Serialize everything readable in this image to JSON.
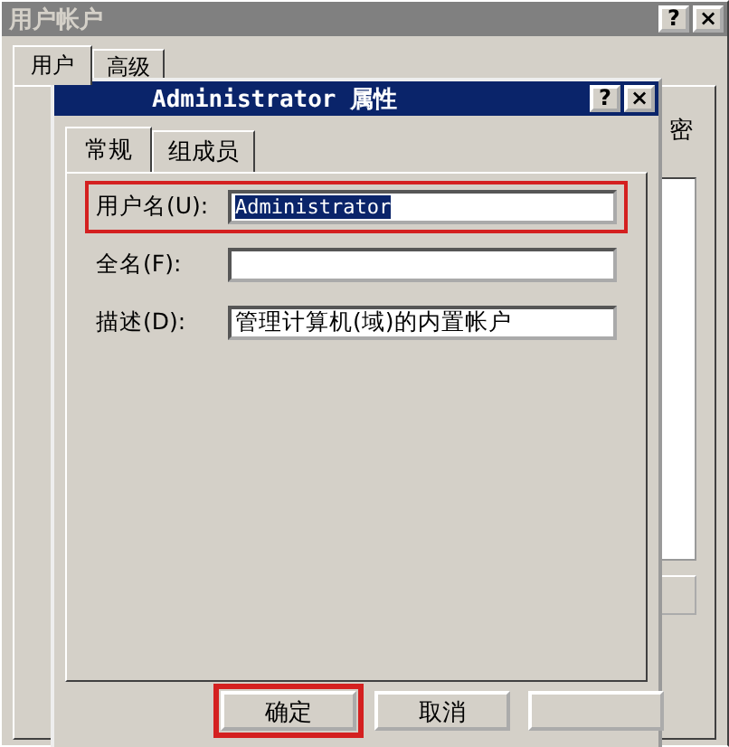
{
  "back_window": {
    "title": "用户帐户",
    "title_buttons": [
      "?",
      "×"
    ],
    "tabs": [
      {
        "label": "用户",
        "selected": true
      },
      {
        "label": "高级",
        "selected": false
      }
    ],
    "side_text": "密"
  },
  "dialog": {
    "title": "Administrator 属性",
    "title_buttons": [
      "?",
      "×"
    ],
    "tabs": [
      {
        "label": "常规",
        "selected": true
      },
      {
        "label": "组成员",
        "selected": false
      }
    ],
    "fields": [
      {
        "label": "用户名(U):",
        "value": "Administrator",
        "value_selected": true,
        "highlighted": true
      },
      {
        "label": "全名(F):",
        "highlighted": false
      },
      {
        "label": "描述(D):",
        "value": "管理计算机(域)的内置帐户",
        "value_selected": false,
        "highlighted": false
      }
    ],
    "buttons": [
      {
        "label": "确定",
        "highlighted": true
      },
      {
        "label": "取消",
        "highlighted": false
      },
      {
        "highlighted": false
      }
    ]
  }
}
